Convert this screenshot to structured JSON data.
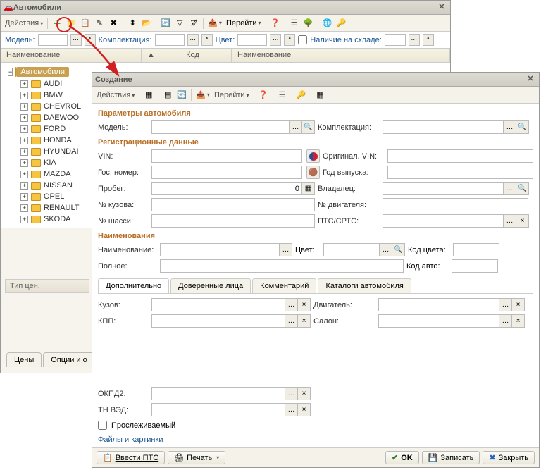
{
  "win1": {
    "title": "Автомобили",
    "actions": "Действия",
    "filters": {
      "model": "Модель:",
      "config": "Комплектация:",
      "color": "Цвет:",
      "stock": "Наличие на складе:"
    },
    "cols": {
      "name": "Наименование",
      "code": "Код",
      "name2": "Наименование"
    },
    "tree_root": "Автомобили",
    "brands": [
      "AUDI",
      "BMW",
      "CHEVROL",
      "DAEWOO",
      "FORD",
      "HONDA",
      "HYUNDAI",
      "KIA",
      "MAZDA",
      "NISSAN",
      "OPEL",
      "RENAULT",
      "SKODA"
    ],
    "priceType": "Тип цен.",
    "tabs": {
      "prices": "Цены",
      "options": "Опции и о"
    }
  },
  "win2": {
    "title": "Создание",
    "actions": "Действия",
    "goto": "Перейти",
    "sections": {
      "params": "Параметры автомобиля",
      "reg": "Регистрационные данные",
      "names": "Наименования"
    },
    "labels": {
      "model": "Модель:",
      "config": "Комплектация:",
      "vin": "VIN:",
      "origVin": "Оригинал. VIN:",
      "gosNum": "Гос. номер:",
      "year": "Год выпуска:",
      "mileage": "Пробег:",
      "mileageVal": "0",
      "owner": "Владелец:",
      "body": "№ кузова:",
      "engine": "№ двигателя:",
      "chassis": "№ шасси:",
      "pts": "ПТС/СРТС:",
      "name": "Наименование:",
      "color": "Цвет:",
      "colorCode": "Код цвета:",
      "full": "Полное:",
      "autoCode": "Код авто:",
      "bodyType": "Кузов:",
      "engineType": "Двигатель:",
      "gearbox": "КПП:",
      "interior": "Салон:",
      "okpd": "ОКПД2:",
      "tnved": "ТН ВЭД:",
      "traceable": "Прослеживаемый"
    },
    "tabs": {
      "extra": "Дополнительно",
      "trusted": "Доверенные лица",
      "comment": "Комментарий",
      "catalogs": "Каталоги автомобиля"
    },
    "files": "Файлы и картинки",
    "buttons": {
      "enterPts": "Ввести ПТС",
      "print": "Печать",
      "ok": "OK",
      "save": "Записать",
      "close": "Закрыть"
    }
  }
}
